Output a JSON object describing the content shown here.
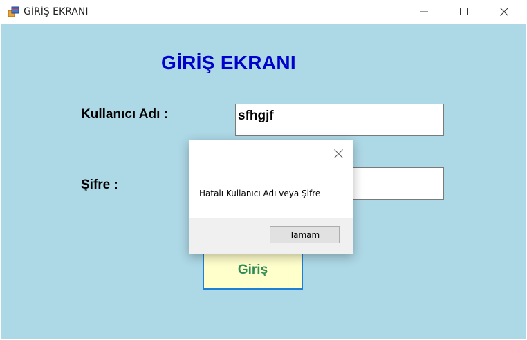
{
  "window": {
    "title": "GİRİŞ EKRANI",
    "icon": "winforms-app-icon"
  },
  "form": {
    "heading": "GİRİŞ EKRANI",
    "username_label": "Kullanıcı Adı :",
    "username_value": "sfhgjf",
    "password_label": "Şifre :",
    "password_value": "",
    "login_button": "Giriş"
  },
  "dialog": {
    "message": "Hatalı Kullanıcı Adı veya Şifre",
    "ok_button": "Tamam"
  },
  "colors": {
    "client_background": "#add8e6",
    "heading": "#0000cd",
    "login_button_bg": "#ffffcc",
    "login_button_text": "#2e8b57",
    "login_button_border": "#1e7fd6"
  }
}
